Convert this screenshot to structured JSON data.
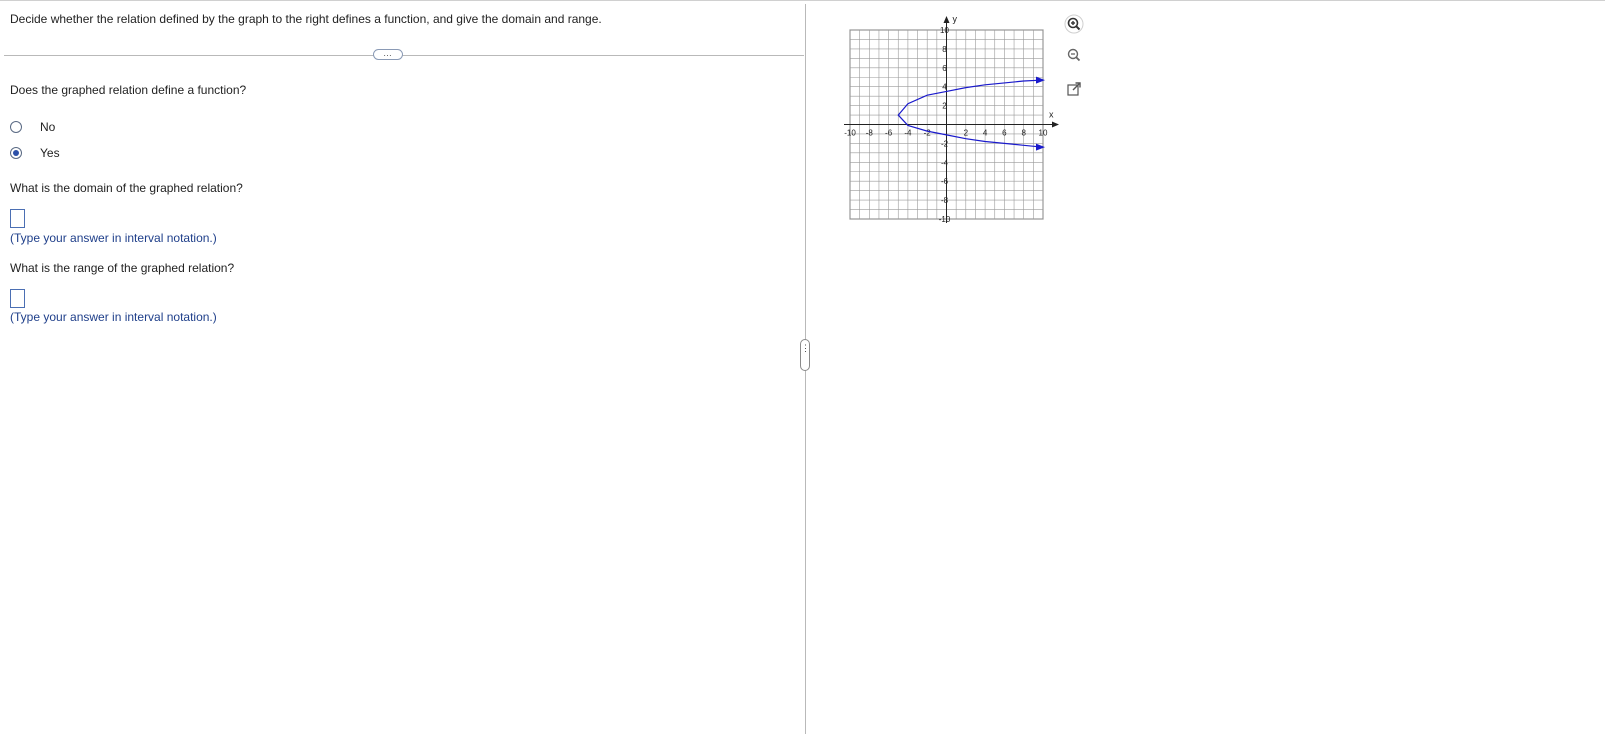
{
  "question": {
    "prompt": "Decide whether the relation defined by the graph to the right defines a function, and give the domain and range.",
    "more_label": "…"
  },
  "q1": {
    "label": "Does the graphed relation define a function?",
    "options": [
      {
        "label": "No",
        "selected": false
      },
      {
        "label": "Yes",
        "selected": true
      }
    ]
  },
  "q2": {
    "label": "What is the domain of the graphed relation?",
    "value": "",
    "hint": "(Type your answer in interval notation.)"
  },
  "q3": {
    "label": "What is the range of the graphed relation?",
    "value": "",
    "hint": "(Type your answer in interval notation.)"
  },
  "splitter_label": "⋮",
  "graph": {
    "x_axis_label": "x",
    "y_axis_label": "y",
    "x_ticks": [
      "-10",
      "-8",
      "-6",
      "-4",
      "-2",
      "2",
      "4",
      "6",
      "8",
      "10"
    ],
    "y_ticks": [
      "10",
      "8",
      "6",
      "4",
      "2",
      "-2",
      "-4",
      "-6",
      "-8",
      "-10"
    ],
    "curve_color": "#1a1acc"
  },
  "chart_data": {
    "type": "line",
    "title": "",
    "xlabel": "x",
    "ylabel": "y",
    "xlim": [
      -10,
      10
    ],
    "ylim": [
      -10,
      10
    ],
    "grid": true,
    "series": [
      {
        "x": [
          10,
          8,
          6,
          4,
          2,
          0,
          -2,
          -4,
          -5,
          -4,
          -2,
          0,
          2,
          4,
          6,
          8,
          10
        ],
        "y": [
          4.7,
          4.6,
          4.4,
          4.2,
          3.9,
          3.5,
          3.1,
          2.2,
          1,
          -0.1,
          -0.7,
          -1.1,
          -1.5,
          -1.8,
          -2,
          -2.2,
          -2.4
        ]
      }
    ],
    "arrows": [
      "upper-right",
      "lower-right"
    ]
  },
  "toolbar": {
    "zoom_in_icon": "zoom-in-icon",
    "zoom_out_icon": "zoom-out-icon",
    "popout_icon": "popout-icon"
  }
}
